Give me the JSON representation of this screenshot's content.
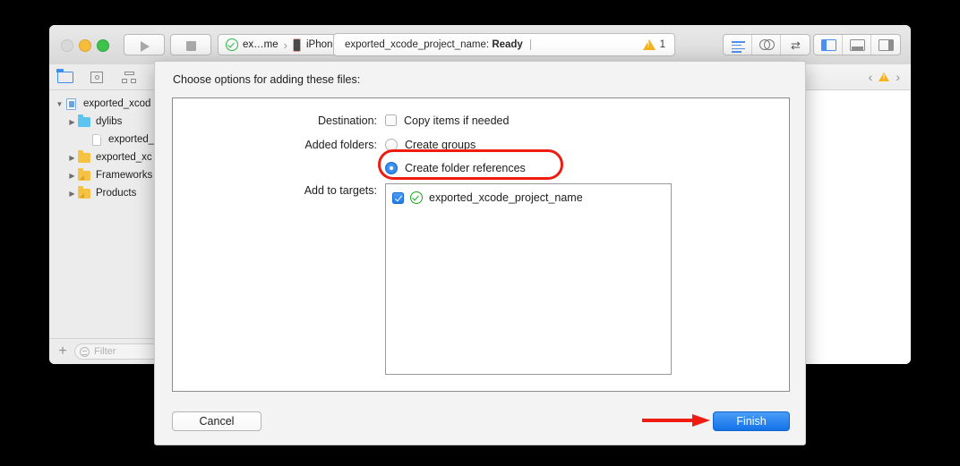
{
  "window": {
    "traffic_lights": [
      "close",
      "minimize",
      "maximize"
    ],
    "toolbar": {
      "run_label": "Run",
      "stop_label": "Stop",
      "scheme": {
        "scheme_name": "ex…me",
        "separator": "›",
        "device_name": "iPhone"
      },
      "status": {
        "text_prefix": "exported_xcode_project_name: ",
        "text_state": "Ready",
        "warning_count": "1"
      },
      "editor_buttons": [
        "standard-editor",
        "assistant-editor",
        "version-editor"
      ],
      "view_buttons": [
        "navigator-toggle",
        "debug-area-toggle",
        "utilities-toggle"
      ]
    }
  },
  "navigator": {
    "tabs": [
      {
        "name": "project-navigator",
        "icon": "folder-icon",
        "active": true
      },
      {
        "name": "issue-navigator",
        "icon": "issue-icon",
        "active": false
      },
      {
        "name": "test-navigator",
        "icon": "hierarchy-icon",
        "active": false
      },
      {
        "name": "find-navigator",
        "icon": "search-icon",
        "active": false
      }
    ],
    "tree": [
      {
        "label": "exported_xcod",
        "icon": "project-icon",
        "depth": 0,
        "twisty": "open"
      },
      {
        "label": "dylibs",
        "icon": "folder-blue-icon",
        "depth": 1,
        "twisty": "closed"
      },
      {
        "label": "exported_xc",
        "icon": "file-icon",
        "depth": 2,
        "twisty": "none"
      },
      {
        "label": "exported_xc",
        "icon": "folder-yellow-icon",
        "depth": 1,
        "twisty": "closed"
      },
      {
        "label": "Frameworks",
        "icon": "folder-group-icon",
        "depth": 1,
        "twisty": "closed"
      },
      {
        "label": "Products",
        "icon": "folder-group-icon",
        "depth": 1,
        "twisty": "closed"
      }
    ],
    "bottom": {
      "add_label": "+",
      "filter_placeholder": "Filter"
    }
  },
  "editor": {
    "jumpbar": {
      "back_label": "‹",
      "forward_label": "›",
      "warning_icon": "warning-triangle-icon"
    }
  },
  "sheet": {
    "title": "Choose options for adding these files:",
    "destination": {
      "label": "Destination:",
      "option_label": "Copy items if needed",
      "checked": false
    },
    "added_folders": {
      "label": "Added folders:",
      "options": [
        {
          "label": "Create groups",
          "selected": false
        },
        {
          "label": "Create folder references",
          "selected": true
        }
      ]
    },
    "add_to_targets": {
      "label": "Add to targets:",
      "rows": [
        {
          "name": "exported_xcode_project_name",
          "checked": true
        }
      ]
    },
    "buttons": {
      "cancel": "Cancel",
      "finish": "Finish"
    }
  },
  "annotations": {
    "highlight_color": "#ef1c12",
    "ellipse_target": "Create folder references",
    "arrow_target": "Finish"
  },
  "colors": {
    "accent_blue": "#1f7ce8",
    "warning_yellow": "#f6b31c",
    "success_green": "#17a81a",
    "annotation_red": "#ef1c12",
    "folder_yellow": "#f5c244",
    "folder_blue": "#5ec3ef"
  }
}
